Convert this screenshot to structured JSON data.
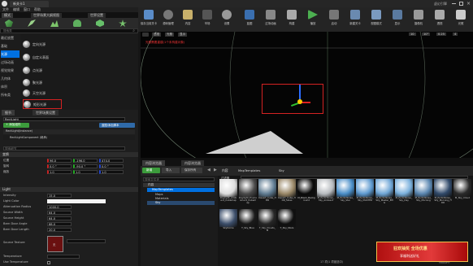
{
  "window": {
    "title": "新关卡1",
    "brand": "虚幻引擎"
  },
  "menubar": {
    "items": [
      "文件",
      "编辑",
      "窗口",
      "帮助"
    ]
  },
  "left_tabs": {
    "tab1": "模式",
    "tab2": "世界场景大纲视图",
    "tab3": "世界设置"
  },
  "place_panel": {
    "search_placeholder": "搜索类",
    "categories": [
      "最近放置",
      "基础",
      "光源",
      "过场动画",
      "视觉效果",
      "几何体",
      "体积",
      "所有类"
    ],
    "items": [
      "指向性光源",
      "点光源",
      "聚光源",
      "天空光源",
      "矩形光源"
    ],
    "items_extra": [
      "定向光源",
      "自定义表面"
    ]
  },
  "details": {
    "tab_details": "细节",
    "tab_world": "世界场景设置",
    "name_value": "RectLight",
    "add_component": "+ 添加组件",
    "blueprint": "蓝图/添加脚本",
    "root_component": "RectLight(Instance)",
    "component": "RectLightComponent (继承)",
    "search_placeholder": "搜索细节",
    "transform_header": "变换",
    "transform_labels": [
      "位置",
      "旋转",
      "缩放"
    ],
    "location": [
      "96.0",
      "-196.0",
      "474.0"
    ],
    "rotation": [
      "0.0 °",
      "-90.0 °",
      "0.0 °"
    ],
    "scale": [
      "1.0",
      "1.0",
      "1.0"
    ],
    "light_header": "Light",
    "light_props": [
      "Intensity",
      "Light Color",
      "Attenuation Radius",
      "Source Width",
      "Source Height",
      "Barn Door Angle",
      "Barn Door Length"
    ],
    "light_values": [
      "15.0",
      "",
      "1000.0",
      "64.0",
      "64.0",
      "88.0",
      "20.0"
    ],
    "source_texture_label": "Source Texture",
    "source_texture_value": "无",
    "temperature_label": "Temperature",
    "use_temperature_label": "Use Temperature"
  },
  "toolbar": {
    "buttons": [
      "保存当前关卡",
      "源码管理",
      "内容",
      "市场",
      "设置",
      "蓝图",
      "过场动画",
      "构建",
      "播放",
      "启动"
    ],
    "extra": [
      "新建关卡",
      "视图模式",
      "显示",
      "摄像机",
      "透视",
      "光照"
    ]
  },
  "viewport": {
    "warning": "光照需要重建(1个未构建对象)",
    "top_labels": [
      "透视",
      "光照",
      "显示"
    ],
    "snap_values": [
      "10",
      "10°",
      "0.25",
      "4"
    ],
    "speed": "1"
  },
  "content_browser": {
    "tab1": "内容浏览器",
    "tab2": "内容浏览器",
    "add_new": "新增",
    "import": "导入",
    "save_all": "保存所有",
    "path": [
      "内容",
      "MapTemplates",
      "Sky"
    ],
    "filters": "过滤器",
    "search_placeholder": "搜索 Sky",
    "tree_search": "搜索文件夹",
    "tree_root": "内容",
    "tree_items": [
      "MapTemplates",
      "Maps",
      "Materials",
      "Sky"
    ],
    "status": "17 项(1 项被选中)",
    "view_options": "视图选项",
    "assets": [
      {
        "name": "Daylight_Ambient_Cubemap",
        "color": "#dcdcdc"
      },
      {
        "name": "Daylight_Environment_Cubemap",
        "color": "#4a4a4a"
      },
      {
        "name": "Desert_Cube_HDR",
        "color": "#607c92"
      },
      {
        "name": "Desert_Cube_HDR_Skies",
        "color": "#9a8868"
      },
      {
        "name": "M_Black_Background",
        "color": "#0a0a0a"
      },
      {
        "name": "M_PerlinNoise_Sky_Ambient",
        "color": "#b8bcc0"
      },
      {
        "name": "M_PerlinNoise_Sky_Star",
        "color": "#4a8ec8"
      },
      {
        "name": "M_PerlinNoise_Sky_MASTER",
        "color": "#5e9ad0"
      },
      {
        "name": "M_PerlinNoise_Sky_Master_ENG",
        "color": "#6fa6d6"
      },
      {
        "name": "M_PerlinNoise_Sky_Day",
        "color": "#7ab0dc"
      },
      {
        "name": "M_PerlinNoise_Sky_Morning",
        "color": "#5a86b0"
      },
      {
        "name": "M_PerlinNoise_Sky_Morning_HDR",
        "color": "#314a6a"
      },
      {
        "name": "M_Sky_Cloud",
        "color": "#2a2a2a"
      },
      {
        "name": "SkyDome",
        "color": "#3c4e6a"
      },
      {
        "name": "T_Sky_Blue",
        "color": "#1a1a1a"
      },
      {
        "name": "T_Sky_Clouds_M",
        "color": "#262626"
      },
      {
        "name": "T_Sky_Stars",
        "color": "#101010"
      }
    ]
  },
  "ad": {
    "text": "狂欢抽奖 全场优惠",
    "sub": "享福利送好礼"
  },
  "colors": {
    "accent": "#0080ff",
    "selection": "#d42222",
    "bg": "#151515"
  }
}
